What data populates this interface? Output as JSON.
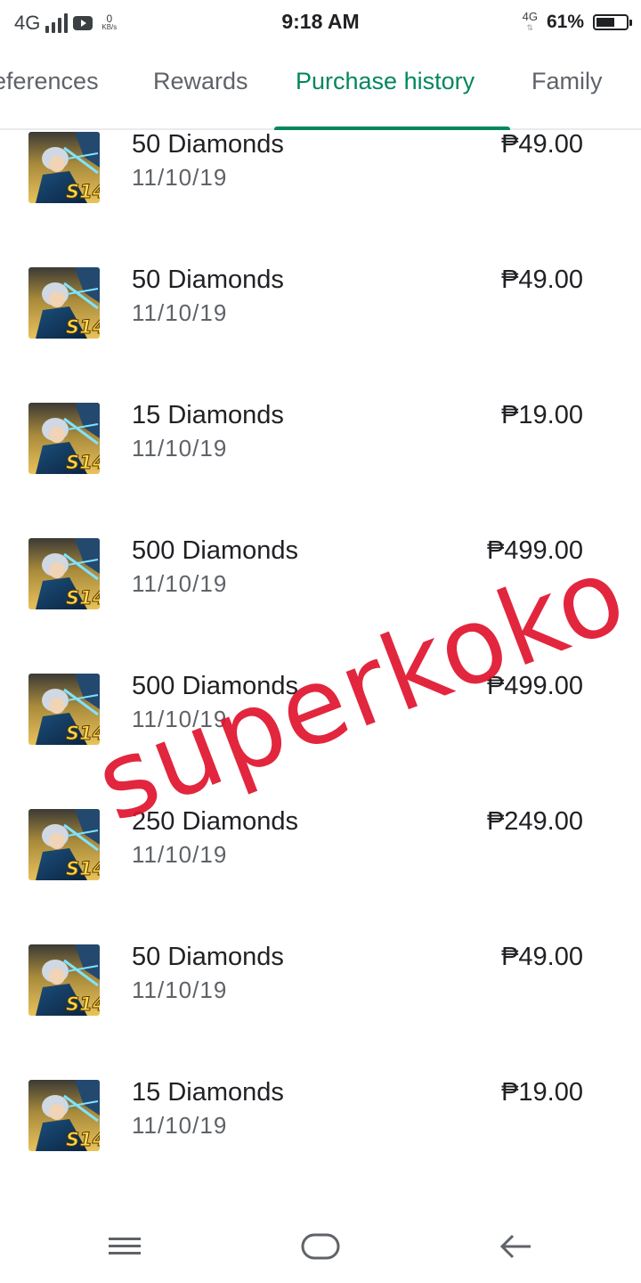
{
  "status_bar": {
    "network_left": "4G",
    "speed_value": "0",
    "speed_unit": "KB/s",
    "time": "9:18 AM",
    "network_right": "4G",
    "battery_percent": "61%",
    "battery_level": 0.61
  },
  "tabs": [
    {
      "label": "eferences",
      "active": false
    },
    {
      "label": "Rewards",
      "active": false
    },
    {
      "label": "Purchase history",
      "active": true
    },
    {
      "label": "Family",
      "active": false
    }
  ],
  "purchases": [
    {
      "title": "50 Diamonds",
      "date": "11/10/19",
      "price": "₱49.00"
    },
    {
      "title": "50 Diamonds",
      "date": "11/10/19",
      "price": "₱49.00"
    },
    {
      "title": "15 Diamonds",
      "date": "11/10/19",
      "price": "₱19.00"
    },
    {
      "title": "500 Diamonds",
      "date": "11/10/19",
      "price": "₱499.00"
    },
    {
      "title": "500 Diamonds",
      "date": "11/10/19",
      "price": "₱499.00"
    },
    {
      "title": "250 Diamonds",
      "date": "11/10/19",
      "price": "₱249.00"
    },
    {
      "title": "50 Diamonds",
      "date": "11/10/19",
      "price": "₱49.00"
    },
    {
      "title": "15 Diamonds",
      "date": "11/10/19",
      "price": "₱19.00"
    }
  ],
  "app_icon": {
    "badge_text": "S14"
  },
  "watermark": "superkoko",
  "nav_bar": {
    "icons": [
      "menu-icon",
      "home-icon",
      "back-icon"
    ]
  },
  "colors": {
    "accent": "#01875f",
    "watermark": "#e0142e"
  }
}
